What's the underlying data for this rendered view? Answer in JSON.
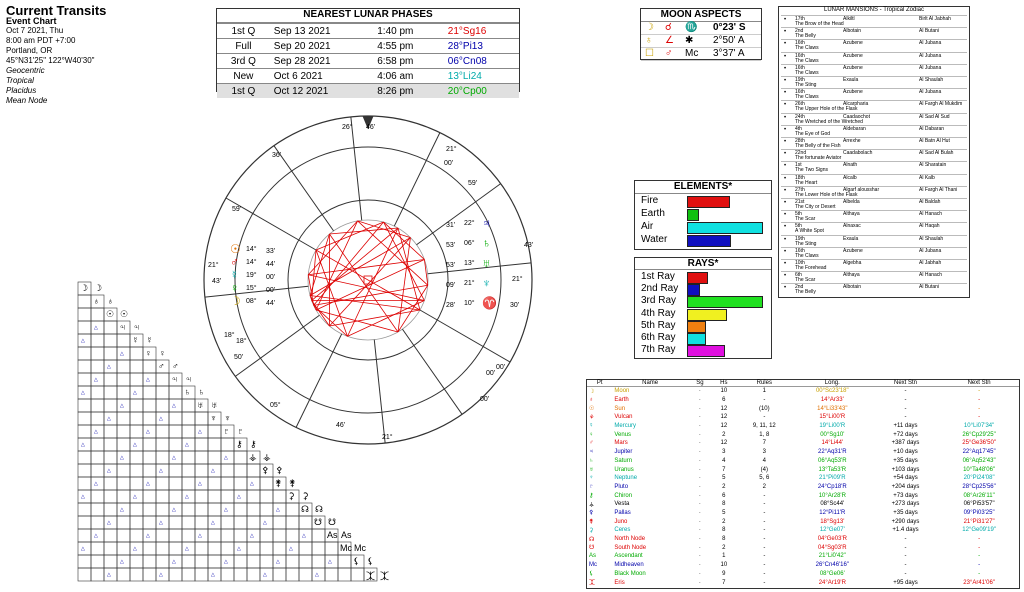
{
  "header": {
    "title": "Current Transits",
    "subtitle": "Event Chart",
    "lines": [
      "Oct 7 2021, Thu",
      "8:00 am  PDT +7:00",
      "Portland, OR",
      "45°N31'25\"  122°W40'30\""
    ],
    "settings": [
      "Geocentric",
      "Tropical",
      "Placidus",
      "Mean Node"
    ]
  },
  "phases": {
    "title": "NEAREST LUNAR PHASES",
    "rows": [
      {
        "phase": "1st Q",
        "date": "Sep 13 2021",
        "time": "1:40 pm",
        "pos": "21°Sg16",
        "color": "#d00"
      },
      {
        "phase": "Full",
        "date": "Sep 20 2021",
        "time": "4:55 pm",
        "pos": "28°Pi13",
        "color": "#00a"
      },
      {
        "phase": "3rd Q",
        "date": "Sep 28 2021",
        "time": "6:58 pm",
        "pos": "06°Cn08",
        "color": "#00a"
      },
      {
        "phase": "New",
        "date": "Oct 6 2021",
        "time": "4:06 am",
        "pos": "13°Li24",
        "color": "#0aa"
      },
      {
        "phase": "1st Q",
        "date": "Oct 12 2021",
        "time": "8:26 pm",
        "pos": "20°Cp00",
        "color": "#0a0"
      }
    ]
  },
  "moon_aspects": {
    "title": "MOON ASPECTS",
    "rows": [
      {
        "g1": "☽",
        "g2": "☌",
        "g3": "♏",
        "value": "0°23' S",
        "bold": true
      },
      {
        "g1": "♁",
        "g2": "∠",
        "g3": "✱",
        "value": "2°50' A",
        "bold": false
      },
      {
        "g1": "☐",
        "g2": "♂",
        "g3": "Mc",
        "value": "3°37' A",
        "bold": false
      }
    ]
  },
  "elements": {
    "title": "ELEMENTS*",
    "items": [
      {
        "name": "Fire",
        "value": 0.55,
        "color": "#e01010"
      },
      {
        "name": "Earth",
        "value": 0.14,
        "color": "#10c010"
      },
      {
        "name": "Air",
        "value": 1.0,
        "color": "#10e0e0"
      },
      {
        "name": "Water",
        "value": 0.57,
        "color": "#1010c0"
      }
    ]
  },
  "rays": {
    "title": "RAYS*",
    "items": [
      {
        "name": "1st Ray",
        "value": 0.26,
        "color": "#e01010"
      },
      {
        "name": "2nd Ray",
        "value": 0.15,
        "color": "#1010c0"
      },
      {
        "name": "3rd Ray",
        "value": 1.0,
        "color": "#20e020"
      },
      {
        "name": "4th Ray",
        "value": 0.52,
        "color": "#f0f020"
      },
      {
        "name": "5th Ray",
        "value": 0.23,
        "color": "#f08010"
      },
      {
        "name": "6th Ray",
        "value": 0.23,
        "color": "#10e0e0"
      },
      {
        "name": "7th Ray",
        "value": 0.49,
        "color": "#e010e0"
      }
    ]
  },
  "mansions": {
    "title": "LUNAR MANSIONS - Tropical Zodiac",
    "rows": [
      {
        "n": "17th",
        "a": "Alkiltl",
        "b": "Birlt Al Jabhah",
        "m": "The Brow of the Head"
      },
      {
        "n": "2nd",
        "a": "Albotain",
        "b": "Al Butani",
        "m": "The Belly"
      },
      {
        "n": "16th",
        "a": "Azubene",
        "b": "Al Jubana",
        "m": "The Claws"
      },
      {
        "n": "16th",
        "a": "Azubene",
        "b": "Al Jubana",
        "m": "The Claws"
      },
      {
        "n": "16th",
        "a": "Azubene",
        "b": "Al Jubana",
        "m": "The Claws"
      },
      {
        "n": "19th",
        "a": "Exaula",
        "b": "Al Shaulah",
        "m": "The Sting"
      },
      {
        "n": "16th",
        "a": "Azubene",
        "b": "Al Jubana",
        "m": "The Claws"
      },
      {
        "n": "26th",
        "a": "Alcarpharia",
        "b": "Al Fargh Al Mukdim",
        "m": "The Upper Hole of the Flask"
      },
      {
        "n": "24th",
        "a": "Caadaochot",
        "b": "Al Sad Al Sud",
        "m": "The Wretched of the Wretched"
      },
      {
        "n": "4th",
        "a": "Aldebaran",
        "b": "Al Dabaran",
        "m": "The Eye of God"
      },
      {
        "n": "28th",
        "a": "Arrexhe",
        "b": "Al Batn Al Hut",
        "m": "The Belly of the Fish"
      },
      {
        "n": "22nd",
        "a": "Caadabolach",
        "b": "Al Sad Al Bulah",
        "m": "The fortunate Aviator"
      },
      {
        "n": "1st",
        "a": "Alnath",
        "b": "Al Sharatain",
        "m": "The Two Signs"
      },
      {
        "n": "18th",
        "a": "Alcalb",
        "b": "Al Kalb",
        "m": "The Heart"
      },
      {
        "n": "27th",
        "a": "Algarf alousshar",
        "b": "Al Fargh Al Thani",
        "m": "The Lower Hole of the Flask"
      },
      {
        "n": "21st",
        "a": "Albelda",
        "b": "Al Baldah",
        "m": "The City or Desert"
      },
      {
        "n": "5th",
        "a": "Althaya",
        "b": "Al Hanach",
        "m": "The Scar"
      },
      {
        "n": "5th",
        "a": "Alnaxac",
        "b": "Al Haqah",
        "m": "A White Spot"
      },
      {
        "n": "19th",
        "a": "Exaula",
        "b": "Al Shaulah",
        "m": "The Sting"
      },
      {
        "n": "16th",
        "a": "Azubene",
        "b": "Al Jubana",
        "m": "The Claws"
      },
      {
        "n": "10th",
        "a": "Algebha",
        "b": "Al Jabhah",
        "m": "The Forehead"
      },
      {
        "n": "6th",
        "a": "Althaya",
        "b": "Al Hanach",
        "m": "The Scar"
      },
      {
        "n": "2nd",
        "a": "Albotain",
        "b": "Al Butani",
        "m": "The Belly"
      }
    ]
  },
  "planets": {
    "headers": [
      "Pt",
      "Name",
      "Sg",
      "Hs",
      "Rules",
      "Long.",
      "Next Stn",
      "Next Stn"
    ],
    "rows": [
      {
        "name": "Moon",
        "hs": "10",
        "rules": "1",
        "long": "00°Sc23'18\"",
        "n1": "-",
        "n2": "-",
        "color": "#c8a000"
      },
      {
        "name": "Earth",
        "hs": "6",
        "rules": "-",
        "long": "14°Ar33'",
        "n1": "-",
        "n2": "-",
        "color": "#d00"
      },
      {
        "name": "Sun",
        "hs": "12",
        "rules": "(10)",
        "long": "14°Li33'43\"",
        "n1": "-",
        "n2": "-",
        "color": "#e07000"
      },
      {
        "name": "Vulcan",
        "hs": "12",
        "rules": "-",
        "long": "15°Li00'R",
        "n1": "-",
        "n2": "-",
        "color": "#d00"
      },
      {
        "name": "Mercury",
        "hs": "12",
        "rules": "9, 11, 12",
        "long": "19°Li00'R",
        "n1": "+11 days",
        "n2": "10°Li07'34\"",
        "color": "#0aa"
      },
      {
        "name": "Venus",
        "hs": "2",
        "rules": "1, 8",
        "long": "00°Sg10'",
        "n1": "+72 days",
        "n2": "26°Cp29'25\"",
        "color": "#0a0"
      },
      {
        "name": "Mars",
        "hs": "12",
        "rules": "7",
        "long": "14°Li44'",
        "n1": "+387 days",
        "n2": "25°Ge36'50\"",
        "color": "#d00"
      },
      {
        "name": "Jupiter",
        "hs": "3",
        "rules": "3",
        "long": "22°Aq31'R",
        "n1": "+10 days",
        "n2": "22°Aq17'45\"",
        "color": "#00a"
      },
      {
        "name": "Saturn",
        "hs": "4",
        "rules": "4",
        "long": "06°Aq53'R",
        "n1": "+35 days",
        "n2": "06°Aq52'43\"",
        "color": "#0a0"
      },
      {
        "name": "Uranus",
        "hs": "7",
        "rules": "(4)",
        "long": "13°Ta53'R",
        "n1": "+103 days",
        "n2": "10°Ta48'06\"",
        "color": "#0a0"
      },
      {
        "name": "Neptune",
        "hs": "5",
        "rules": "5, 6",
        "long": "21°Pi09'R",
        "n1": "+54 days",
        "n2": "20°Pi24'08\"",
        "color": "#0aa"
      },
      {
        "name": "Pluto",
        "hs": "2",
        "rules": "2",
        "long": "24°Cp18'R",
        "n1": "+204 days",
        "n2": "28°Cp25'56\"",
        "color": "#00a"
      },
      {
        "name": "Chiron",
        "hs": "6",
        "rules": "-",
        "long": "10°Ar28'R",
        "n1": "+73 days",
        "n2": "08°Ar26'11\"",
        "color": "#0a0"
      },
      {
        "name": "Vesta",
        "hs": "8",
        "rules": "-",
        "long": "08°Sc44'",
        "n1": "+273 days",
        "n2": "06°Pi53'57\"",
        "color": "#000"
      },
      {
        "name": "Pallas",
        "hs": "5",
        "rules": "-",
        "long": "12°Pi11'R",
        "n1": "+35 days",
        "n2": "09°Pi03'25\"",
        "color": "#00a"
      },
      {
        "name": "Juno",
        "hs": "2",
        "rules": "-",
        "long": "18°Sg13'",
        "n1": "+290 days",
        "n2": "21°Pi31'27\"",
        "color": "#d00"
      },
      {
        "name": "Ceres",
        "hs": "8",
        "rules": "-",
        "long": "12°Ge07'",
        "n1": "+1.4 days",
        "n2": "12°Ge09'19\"",
        "color": "#0aa"
      },
      {
        "name": "North Node",
        "hs": "8",
        "rules": "-",
        "long": "04°Ge03'R",
        "n1": "-",
        "n2": "-",
        "color": "#d00"
      },
      {
        "name": "South Node",
        "hs": "2",
        "rules": "-",
        "long": "04°Sg03'R",
        "n1": "-",
        "n2": "-",
        "color": "#d00"
      },
      {
        "name": "Ascendant",
        "hs": "1",
        "rules": "-",
        "long": "21°Li0'42\"",
        "n1": "-",
        "n2": "-",
        "color": "#0a0"
      },
      {
        "name": "Midheaven",
        "hs": "10",
        "rules": "-",
        "long": "26°Cn46'16\"",
        "n1": "-",
        "n2": "-",
        "color": "#00a"
      },
      {
        "name": "Black Moon",
        "hs": "9",
        "rules": "-",
        "long": "08°Ge06'",
        "n1": "-",
        "n2": "-",
        "color": "#0a0"
      },
      {
        "name": "Eris",
        "hs": "7",
        "rules": "-",
        "long": "24°Ar19'R",
        "n1": "+95 days",
        "n2": "23°Ar41'06\"",
        "color": "#d00"
      }
    ]
  },
  "wheel": {
    "cusp_labels": [
      "26°",
      "46'",
      "21°",
      "00'",
      "36'",
      "59'",
      "21°",
      "43'",
      "18°",
      "50'",
      "05°",
      "46'",
      "21°",
      "00'",
      "00'",
      "30'",
      "21°",
      "43'",
      "59'",
      "18°",
      "00'"
    ],
    "glyphs_left": [
      {
        "g": "☉",
        "t": "14°",
        "m": "33'",
        "c": "#e07000"
      },
      {
        "g": "♂",
        "t": "14°",
        "m": "44'",
        "c": "#d00"
      },
      {
        "g": "☿",
        "t": "19°",
        "m": "00'",
        "c": "#0aa"
      },
      {
        "g": "♀",
        "t": "15°",
        "m": "00'",
        "c": "#0a0"
      },
      {
        "g": "☽",
        "t": "08°",
        "m": "44'",
        "c": "#c8a000"
      }
    ],
    "glyphs_right": [
      {
        "g": "♃",
        "t": "22°",
        "m": "31'",
        "c": "#00a"
      },
      {
        "g": "♄",
        "t": "06°",
        "m": "53'",
        "c": "#0a0"
      },
      {
        "g": "♅",
        "t": "13°",
        "m": "53'",
        "c": "#0a0"
      },
      {
        "g": "♆",
        "t": "21°",
        "m": "09'",
        "c": "#0aa"
      },
      {
        "g": "♈",
        "t": "10°",
        "m": "28'",
        "c": "#d00"
      }
    ]
  },
  "grid": {
    "symbols": [
      "☽",
      "♁",
      "☉",
      "♃",
      "☿",
      "♀",
      "♂",
      "♃",
      "♄",
      "♅",
      "♆",
      "♇",
      "⚷",
      "⚶",
      "⚴",
      "⚵",
      "⚳",
      "☊",
      "☋",
      "As",
      "Mc",
      "⚸",
      "⯰"
    ]
  },
  "colors": {
    "red": "#d00",
    "blue": "#00a",
    "green": "#0a0",
    "cyan": "#0aa",
    "orange": "#e07000"
  }
}
